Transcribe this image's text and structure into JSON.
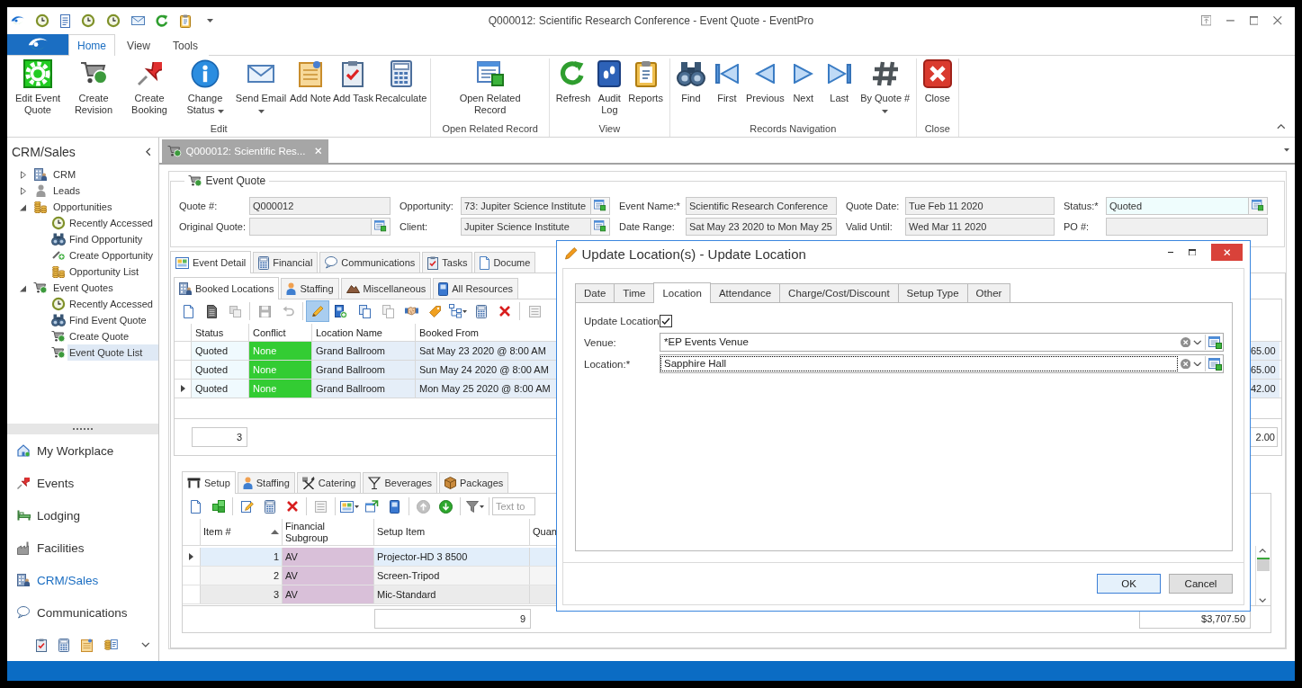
{
  "window": {
    "title": "Q000012: Scientific Research Conference - Event Quote - EventPro"
  },
  "ribbon": {
    "tabs": [
      {
        "label": "Home",
        "selected": true
      },
      {
        "label": "View",
        "selected": false
      },
      {
        "label": "Tools",
        "selected": false
      }
    ],
    "groups": [
      {
        "label": "Edit",
        "buttons": [
          {
            "label": "Edit Event Quote",
            "dropdown": false
          },
          {
            "label": "Create Revision",
            "dropdown": false
          },
          {
            "label": "Create Booking",
            "dropdown": false
          },
          {
            "label": "Change Status",
            "dropdown": true
          },
          {
            "label": "Send Email",
            "dropdown": true
          },
          {
            "label": "Add Note",
            "dropdown": false
          },
          {
            "label": "Add Task",
            "dropdown": false
          },
          {
            "label": "Recalculate",
            "dropdown": false
          }
        ]
      },
      {
        "label": "Open Related Record",
        "buttons": [
          {
            "label": "Open Related Record",
            "dropdown": false
          }
        ]
      },
      {
        "label": "View",
        "buttons": [
          {
            "label": "Refresh",
            "dropdown": false
          },
          {
            "label": "Audit Log",
            "dropdown": false
          },
          {
            "label": "Reports",
            "dropdown": false
          }
        ]
      },
      {
        "label": "Records Navigation",
        "buttons": [
          {
            "label": "Find",
            "dropdown": false
          },
          {
            "label": "First",
            "dropdown": false
          },
          {
            "label": "Previous",
            "dropdown": false
          },
          {
            "label": "Next",
            "dropdown": false
          },
          {
            "label": "Last",
            "dropdown": false
          },
          {
            "label": "By Quote #",
            "dropdown": true
          }
        ]
      },
      {
        "label": "Close",
        "buttons": [
          {
            "label": "Close",
            "dropdown": false
          }
        ]
      }
    ]
  },
  "sidebar": {
    "title": "CRM/Sales",
    "tree": [
      {
        "label": "CRM",
        "expanded": false,
        "selected": false
      },
      {
        "label": "Leads",
        "expanded": false,
        "selected": false
      },
      {
        "label": "Opportunities",
        "expanded": true,
        "selected": false,
        "children": [
          {
            "label": "Recently Accessed",
            "selected": false
          },
          {
            "label": "Find Opportunity",
            "selected": false
          },
          {
            "label": "Create Opportunity",
            "selected": false
          },
          {
            "label": "Opportunity List",
            "selected": false
          }
        ]
      },
      {
        "label": "Event Quotes",
        "expanded": true,
        "selected": false,
        "children": [
          {
            "label": "Recently Accessed",
            "selected": false
          },
          {
            "label": "Find Event Quote",
            "selected": false
          },
          {
            "label": "Create Quote",
            "selected": false
          },
          {
            "label": "Event Quote List",
            "selected": true
          }
        ]
      }
    ],
    "nav": [
      {
        "label": "My Workplace",
        "selected": false
      },
      {
        "label": "Events",
        "selected": false
      },
      {
        "label": "Lodging",
        "selected": false
      },
      {
        "label": "Facilities",
        "selected": false
      },
      {
        "label": "CRM/Sales",
        "selected": true
      },
      {
        "label": "Communications",
        "selected": false
      }
    ]
  },
  "document_tab": {
    "label": "Q000012: Scientific Res...",
    "selected": true
  },
  "event_quote": {
    "title": "Event Quote",
    "fields": [
      {
        "label": "Quote #:",
        "value": "Q000012",
        "lookup": false,
        "focused": false
      },
      {
        "label": "Opportunity:",
        "value": "73: Jupiter Science Institute",
        "lookup": true,
        "focused": false
      },
      {
        "label": "Event Name:*",
        "value": "Scientific Research Conference",
        "lookup": false,
        "focused": false
      },
      {
        "label": "Quote Date:",
        "value": "Tue Feb 11 2020",
        "lookup": false,
        "focused": false
      },
      {
        "label": "Status:*",
        "value": "Quoted",
        "lookup": true,
        "focused": true
      },
      {
        "label": "Original Quote:",
        "lookup": true,
        "focused": false
      },
      {
        "label": "Client:",
        "value": "Jupiter Science Institute",
        "lookup": true,
        "focused": false
      },
      {
        "label": "Date Range:",
        "value": "Sat May 23 2020 to Mon May 25",
        "lookup": false,
        "focused": false
      },
      {
        "label": "Valid Until:",
        "value": "Wed Mar 11 2020",
        "lookup": false,
        "focused": false
      },
      {
        "label": "PO #:",
        "lookup": false,
        "focused": false
      }
    ]
  },
  "detail_tabs": [
    {
      "label": "Event Detail",
      "selected": true
    },
    {
      "label": "Financial",
      "selected": false
    },
    {
      "label": "Communications",
      "selected": false
    },
    {
      "label": "Tasks",
      "selected": false
    },
    {
      "label": "Docume",
      "selected": false
    }
  ],
  "booked_locations": {
    "tabs": [
      {
        "label": "Booked Locations",
        "selected": true
      },
      {
        "label": "Staffing",
        "selected": false
      },
      {
        "label": "Miscellaneous",
        "selected": false
      },
      {
        "label": "All Resources",
        "selected": false
      }
    ],
    "toolbar": [
      {
        "pressed": false,
        "disabled": false,
        "dropdown": false
      },
      {
        "pressed": false,
        "disabled": false,
        "dropdown": false
      },
      {
        "pressed": false,
        "disabled": true,
        "dropdown": false
      },
      {
        "pressed": false,
        "disabled": true,
        "dropdown": false
      },
      {
        "pressed": false,
        "disabled": true,
        "dropdown": false
      },
      {
        "pressed": true,
        "disabled": false,
        "dropdown": false
      },
      {
        "pressed": false,
        "disabled": false,
        "dropdown": false
      },
      {
        "pressed": false,
        "disabled": false,
        "dropdown": false
      },
      {
        "pressed": false,
        "disabled": true,
        "dropdown": false
      },
      {
        "pressed": false,
        "disabled": false,
        "dropdown": false
      },
      {
        "pressed": false,
        "disabled": false,
        "dropdown": false
      },
      {
        "pressed": false,
        "disabled": false,
        "dropdown": true
      },
      {
        "pressed": false,
        "disabled": false,
        "dropdown": false
      },
      {
        "pressed": false,
        "disabled": false,
        "dropdown": false
      },
      {
        "pressed": false,
        "disabled": true,
        "dropdown": false
      }
    ],
    "columns": [
      "Status",
      "Conflict",
      "Location Name",
      "Booked From"
    ],
    "rows": [
      {
        "current": false,
        "status": "Quoted",
        "conflict": {
          "text": "None",
          "color": "#33cc33"
        },
        "location_name": "Grand Ballroom",
        "booked_from": "Sat May 23 2020 @ 8:00 AM",
        "column_5": "65.00"
      },
      {
        "current": false,
        "status": "Quoted",
        "conflict": {
          "text": "None",
          "color": "#33cc33"
        },
        "location_name": "Grand Ballroom",
        "booked_from": "Sun May 24 2020 @ 8:00 AM",
        "column_5": "65.00"
      },
      {
        "current": true,
        "status": "Quoted",
        "conflict": {
          "text": "None",
          "color": "#33cc33"
        },
        "location_name": "Grand Ballroom",
        "booked_from": "Mon May 25 2020 @ 8:00 AM",
        "column_5": "42.00"
      }
    ],
    "count": "3",
    "column_5_total": "2.00"
  },
  "setup": {
    "tabs": [
      {
        "label": "Setup",
        "selected": true
      },
      {
        "label": "Staffing",
        "selected": false
      },
      {
        "label": "Catering",
        "selected": false
      },
      {
        "label": "Beverages",
        "selected": false
      },
      {
        "label": "Packages",
        "selected": false
      }
    ],
    "toolbar": [
      {
        "pressed": false,
        "disabled": false,
        "dropdown": false
      },
      {
        "pressed": false,
        "disabled": false,
        "dropdown": false
      },
      {
        "pressed": false,
        "disabled": false,
        "dropdown": false
      },
      {
        "pressed": false,
        "disabled": false,
        "dropdown": false
      },
      {
        "pressed": false,
        "disabled": false,
        "dropdown": false
      },
      {
        "pressed": false,
        "disabled": true,
        "dropdown": false
      },
      {
        "pressed": false,
        "disabled": false,
        "dropdown": true
      },
      {
        "pressed": false,
        "disabled": false,
        "dropdown": false
      },
      {
        "pressed": false,
        "disabled": false,
        "dropdown": false
      },
      {
        "pressed": false,
        "disabled": true,
        "dropdown": false
      },
      {
        "pressed": false,
        "disabled": false,
        "dropdown": false
      },
      {
        "pressed": false,
        "disabled": false,
        "dropdown": true
      }
    ],
    "search": {
      "placeholder": "Text to"
    },
    "columns": [
      {
        "label": "Item #",
        "sort_ascending": true
      },
      {
        "label": "Financial Subgroup",
        "sort_ascending": false
      },
      {
        "label": "Setup Item",
        "sort_ascending": false
      },
      {
        "label": "Quan"
      }
    ],
    "rows": [
      {
        "current": true,
        "item": "1",
        "subgroup": {
          "text": "AV",
          "color": "#d9c0d9"
        },
        "setup_item": "Projector-HD 3 8500"
      },
      {
        "current": false,
        "item": "2",
        "subgroup": {
          "text": "AV",
          "color": "#d9c0d9"
        },
        "setup_item": "Screen-Tripod"
      },
      {
        "current": false,
        "item": "3",
        "subgroup": {
          "text": "AV",
          "color": "#d9c0d9"
        },
        "setup_item": "Mic-Standard"
      }
    ],
    "totals": {
      "setup_item": "9",
      "column_5": "$3,707.50"
    }
  },
  "dialog": {
    "title": "Update Location(s) - Update Location",
    "tabs": [
      {
        "label": "Date",
        "selected": false
      },
      {
        "label": "Time",
        "selected": false
      },
      {
        "label": "Location",
        "selected": true
      },
      {
        "label": "Attendance",
        "selected": false
      },
      {
        "label": "Charge/Cost/Discount",
        "selected": false
      },
      {
        "label": "Setup Type",
        "selected": false
      },
      {
        "label": "Other",
        "selected": false
      }
    ],
    "update_location": {
      "label": "Update Location",
      "checked": true
    },
    "fields": [
      {
        "label": "Venue:",
        "value": "*EP Events Venue",
        "focused": false
      },
      {
        "label": "Location:*",
        "value": "Sapphire Hall",
        "focused": true
      }
    ],
    "buttons": [
      {
        "label": "OK",
        "default": true
      },
      {
        "label": "Cancel",
        "default": false
      }
    ]
  }
}
